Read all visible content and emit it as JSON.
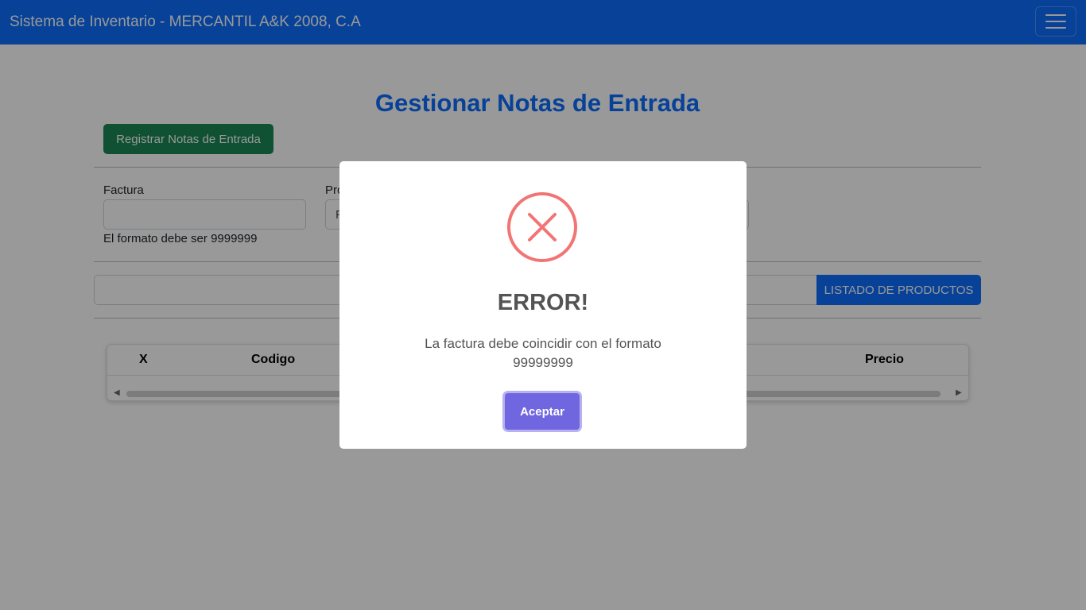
{
  "navbar": {
    "brand": "Sistema de Inventario - MERCANTIL A&K 2008, C.A",
    "toggler_icon": "hamburger-icon",
    "background_color": "#0d6efd"
  },
  "page": {
    "title": "Gestionar Notas de Entrada",
    "register_button": "Registrar Notas de Entrada",
    "factura_label": "Factura",
    "factura_value": "",
    "factura_help": "El formato debe ser 9999999",
    "proveedor_label_partial": "Pro",
    "proveedor_value_partial": "F",
    "search_value": "",
    "listado_button": "LISTADO DE PRODUCTOS"
  },
  "table": {
    "headers": [
      "X",
      "Codigo",
      "Precio"
    ]
  },
  "dialog": {
    "icon": "error-x-icon",
    "title": "ERROR!",
    "message": "La factura debe coincidir con el formato 99999999",
    "confirm_button": "Aceptar",
    "error_color": "#f27474",
    "confirm_color": "#7066e0"
  }
}
